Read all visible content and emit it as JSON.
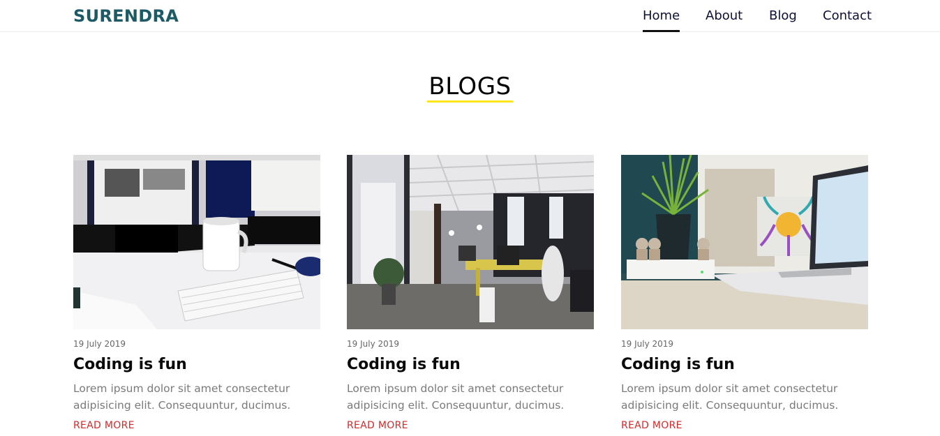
{
  "nav": {
    "brand": "SURENDRA",
    "links": [
      "Home",
      "About",
      "Blog",
      "Contact"
    ],
    "active": "Home"
  },
  "section": {
    "title": "BLOGS"
  },
  "posts": [
    {
      "date": "19 July 2019",
      "title": "Coding is fun",
      "excerpt": "Lorem ipsum dolor sit amet consectetur adipisicing elit. Consequuntur, ducimus.",
      "read_more": "READ MORE",
      "image": "desk-workspace-photo"
    },
    {
      "date": "19 July 2019",
      "title": "Coding is fun",
      "excerpt": "Lorem ipsum dolor sit amet consectetur adipisicing elit. Consequuntur, ducimus.",
      "read_more": "READ MORE",
      "image": "office-interior-photo"
    },
    {
      "date": "19 July 2019",
      "title": "Coding is fun",
      "excerpt": "Lorem ipsum dolor sit amet consectetur adipisicing elit. Consequuntur, ducimus.",
      "read_more": "READ MORE",
      "image": "plant-laptop-photo"
    }
  ],
  "colors": {
    "brand": "#1c5a66",
    "nav_text": "#0b1034",
    "title_underline": "#ffe51a",
    "read_more": "#d42a2a"
  }
}
